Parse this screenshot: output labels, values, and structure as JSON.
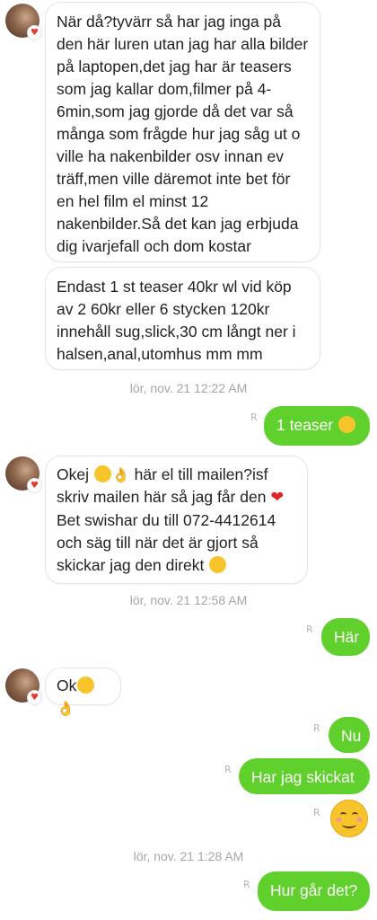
{
  "messages": {
    "m1": "När då?tyvärr så har jag inga på den här luren utan jag har alla bilder på laptopen,det jag har är teasers som jag kallar dom,filmer på 4-6min,som jag gjorde då det var så många som frågde hur jag såg ut o ville ha nakenbilder osv innan ev träff,men ville däremot inte bet för en hel film el minst 12 nakenbilder.Så det kan jag erbjuda dig ivarjefall och dom kostar",
    "m2": "Endast 1 st teaser 40kr wl vid köp av 2 60kr  eller 6 stycken 120kr innehåll sug,slick,30 cm långt ner i halsen,anal,utomhus mm mm",
    "m3_out": "1 teaser",
    "m4_l1_a": "Okej",
    "m4_l1_b": "här el till mailen?isf",
    "m4_l2": "skriv mailen här så jag får den",
    "m4_l3": "Bet swishar du till 072-4412614",
    "m4_l4": "och säg till när det är gjort så",
    "m4_l5": "skickar jag den direkt",
    "m5_out": "Här",
    "m6": "Ok",
    "m7_out": "Nu",
    "m8_out": "Har jag skickat",
    "m10_out": "Hur går det?"
  },
  "timestamps": {
    "t1": "lör, nov. 21 12:22 AM",
    "t2": "lör, nov. 21 12:58 AM",
    "t3": "lör, nov. 21 1:28 AM"
  },
  "read_mark": "R",
  "heart": "♥",
  "colors": {
    "outgoing_bubble": "#5fd02c",
    "incoming_border": "#e5e5e5",
    "timestamp": "#a6a6a6"
  },
  "icons": [
    "avatar",
    "heart-icon",
    "read-receipt-icon",
    "smiling-face-icon",
    "kiss-face-icon",
    "ok-hand-icon",
    "red-heart-icon",
    "hearts-face-icon",
    "relieved-face-icon"
  ]
}
